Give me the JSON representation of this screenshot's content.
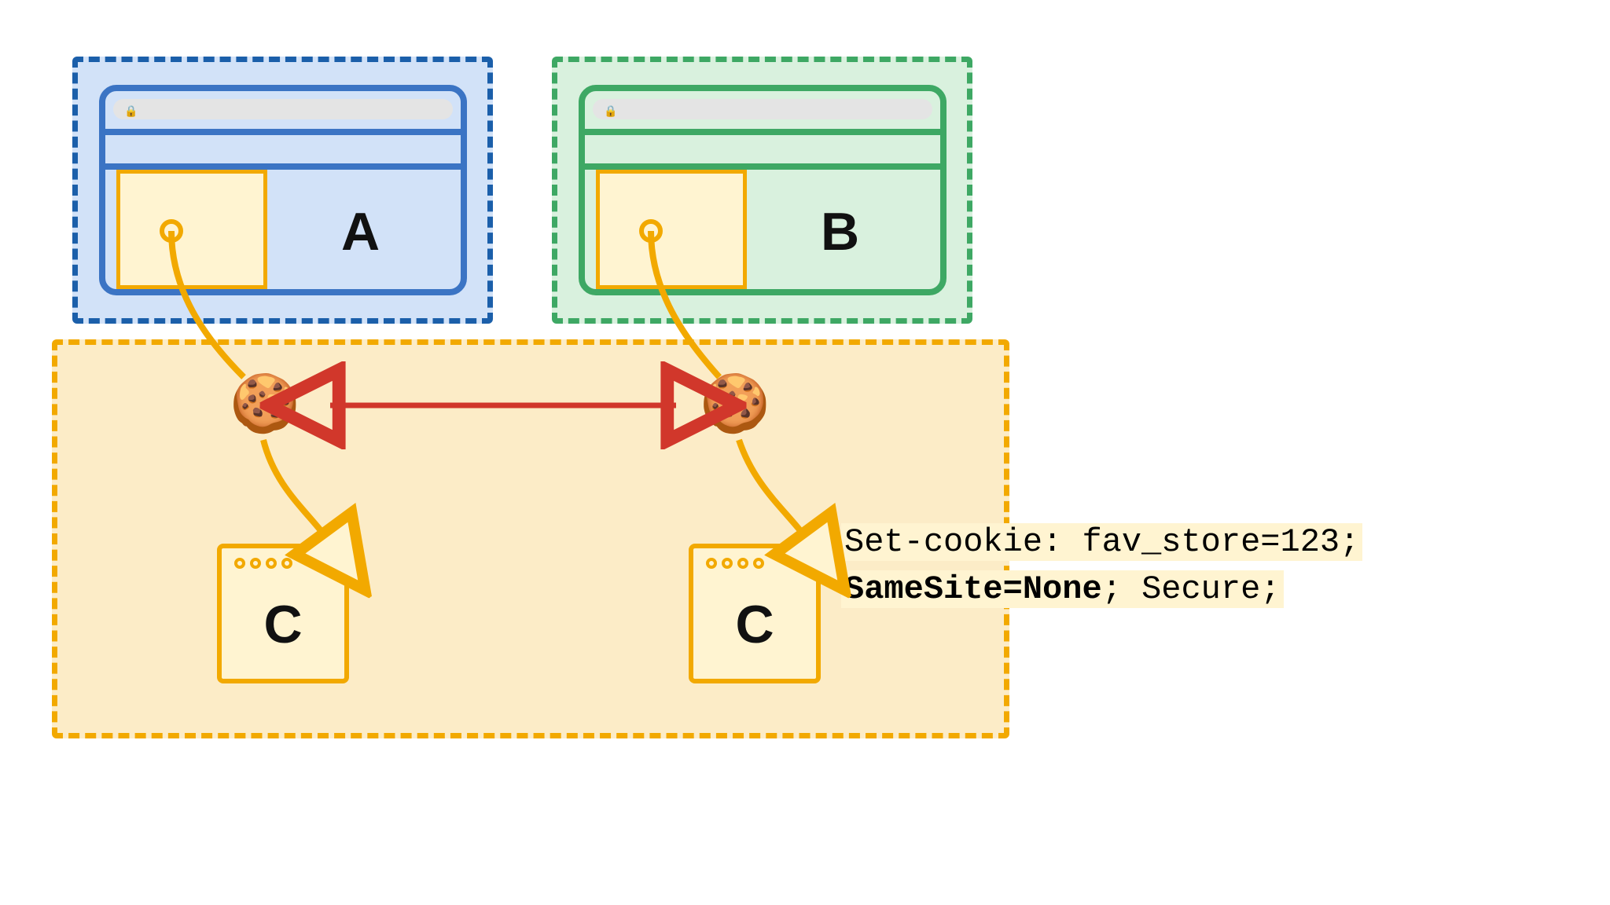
{
  "labels": {
    "siteA": "A",
    "siteB": "B",
    "targetC": "C"
  },
  "lock_glyph": "🔒",
  "cookie_glyph": "🍪",
  "code": {
    "line1": "Set-cookie: fav_store=123;",
    "bold": "SameSite=None",
    "rest": "; Secure;"
  },
  "colors": {
    "blue": "#1b5faa",
    "green": "#3ea864",
    "orange": "#f2a900",
    "red": "#d1372b",
    "highlight": "#fff4d1"
  }
}
